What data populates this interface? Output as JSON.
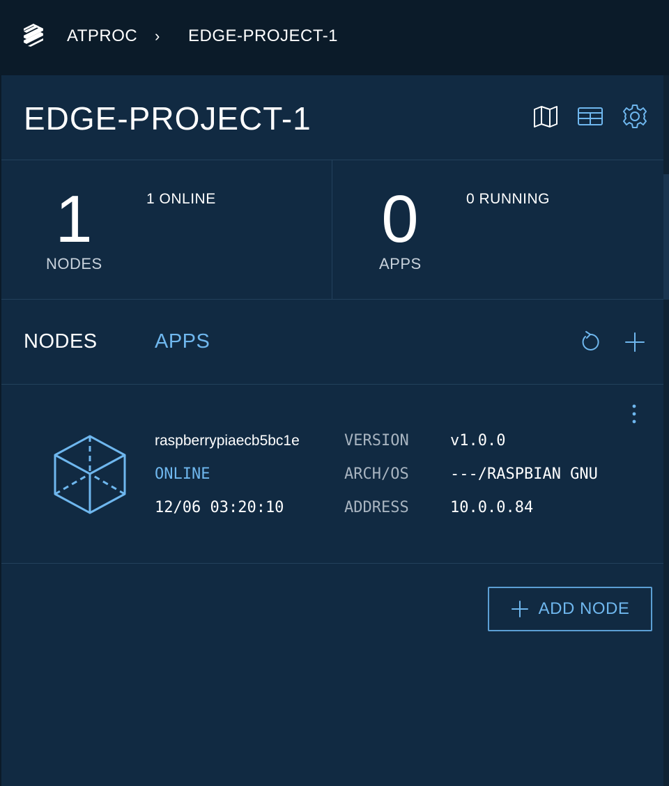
{
  "breadcrumb": {
    "org": "ATPROC",
    "separator": "›",
    "project": "EDGE-PROJECT-1"
  },
  "header": {
    "title": "EDGE-PROJECT-1",
    "icons": [
      "map-icon",
      "table-icon",
      "gear-icon"
    ]
  },
  "stats": {
    "nodes": {
      "count": "1",
      "label": "NODES",
      "sub": "1 ONLINE"
    },
    "apps": {
      "count": "0",
      "label": "APPS",
      "sub": "0 RUNNING"
    }
  },
  "tabs": {
    "nodes": "NODES",
    "apps": "APPS",
    "icons": [
      "refresh-icon",
      "plus-icon"
    ]
  },
  "node": {
    "name": "raspberrypiaecb5bc1e",
    "status": "ONLINE",
    "timestamp": "12/06 03:20:10",
    "props": [
      {
        "label": "VERSION",
        "value": "v1.0.0"
      },
      {
        "label": "ARCH/OS",
        "value": "---/RASPBIAN GNU"
      },
      {
        "label": "ADDRESS",
        "value": "10.0.0.84"
      }
    ]
  },
  "actions": {
    "add_node": "ADD NODE"
  },
  "colors": {
    "accent": "#6fb7ee",
    "panel": "#112a42",
    "topbar": "#0b1b29",
    "divider": "#23415c"
  }
}
